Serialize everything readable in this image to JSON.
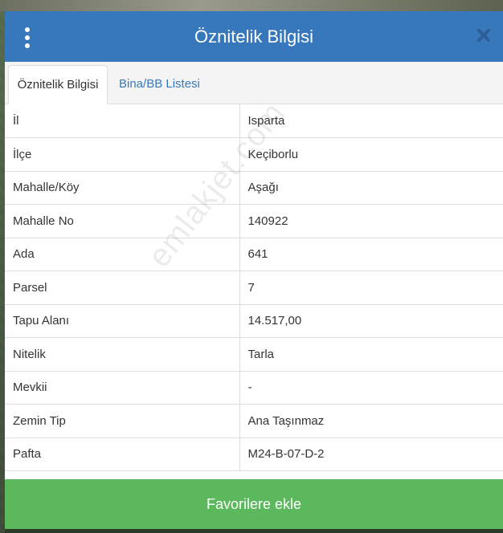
{
  "dialog": {
    "title": "Öznitelik Bilgisi",
    "tabs": [
      {
        "label": "Öznitelik Bilgisi",
        "active": true
      },
      {
        "label": "Bina/BB Listesi",
        "active": false
      }
    ],
    "rows": [
      {
        "key": "İl",
        "value": "Isparta"
      },
      {
        "key": "İlçe",
        "value": "Keçiborlu"
      },
      {
        "key": "Mahalle/Köy",
        "value": "Aşağı"
      },
      {
        "key": "Mahalle No",
        "value": "140922"
      },
      {
        "key": "Ada",
        "value": "641"
      },
      {
        "key": "Parsel",
        "value": "7"
      },
      {
        "key": "Tapu Alanı",
        "value": "14.517,00"
      },
      {
        "key": "Nitelik",
        "value": "Tarla"
      },
      {
        "key": "Mevkii",
        "value": "-"
      },
      {
        "key": "Zemin Tip",
        "value": "Ana Taşınmaz"
      },
      {
        "key": "Pafta",
        "value": "M24-B-07-D-2"
      }
    ],
    "favorite_button": "Favorilere ekle",
    "watermark": "emlakjet.com"
  },
  "icons": {
    "menu": "vertical-dots-icon",
    "close": "close-icon"
  },
  "colors": {
    "header": "#3778bd",
    "tab_link": "#3778bd",
    "favorite_button": "#5cb85c"
  }
}
